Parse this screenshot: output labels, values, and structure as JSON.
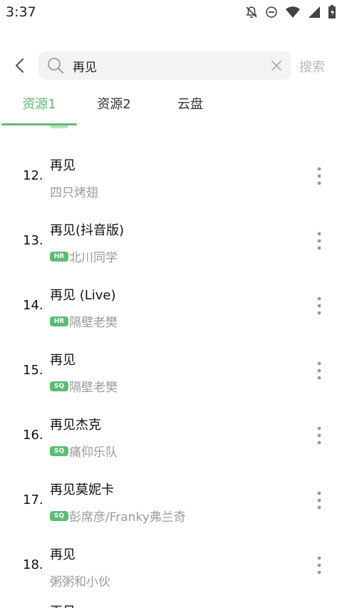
{
  "status": {
    "time": "3:37"
  },
  "search": {
    "query": "再见",
    "button_label": "搜索"
  },
  "tabs": [
    {
      "label": "资源1",
      "active": true
    },
    {
      "label": "资源2",
      "active": false
    },
    {
      "label": "云盘",
      "active": false
    }
  ],
  "results": [
    {
      "num": "12.",
      "title": "再见",
      "badge": "",
      "artist": "四只烤翅"
    },
    {
      "num": "13.",
      "title": "再见(抖音版)",
      "badge": "HR",
      "artist": "北川同学"
    },
    {
      "num": "14.",
      "title": "再见 (Live)",
      "badge": "HR",
      "artist": "隔壁老樊"
    },
    {
      "num": "15.",
      "title": "再见",
      "badge": "SQ",
      "artist": "隔壁老樊"
    },
    {
      "num": "16.",
      "title": "再见杰克",
      "badge": "SQ",
      "artist": "痛仰乐队"
    },
    {
      "num": "17.",
      "title": "再见莫妮卡",
      "badge": "SQ",
      "artist": "彭席彦/Franky弗兰奇"
    },
    {
      "num": "18.",
      "title": "再见",
      "badge": "",
      "artist": "粥粥和小伙"
    }
  ],
  "partial": {
    "top_artist": "",
    "bottom_title": "再见"
  },
  "colors": {
    "accent": "#5cbd72",
    "subtitle": "#9a9a9a"
  }
}
